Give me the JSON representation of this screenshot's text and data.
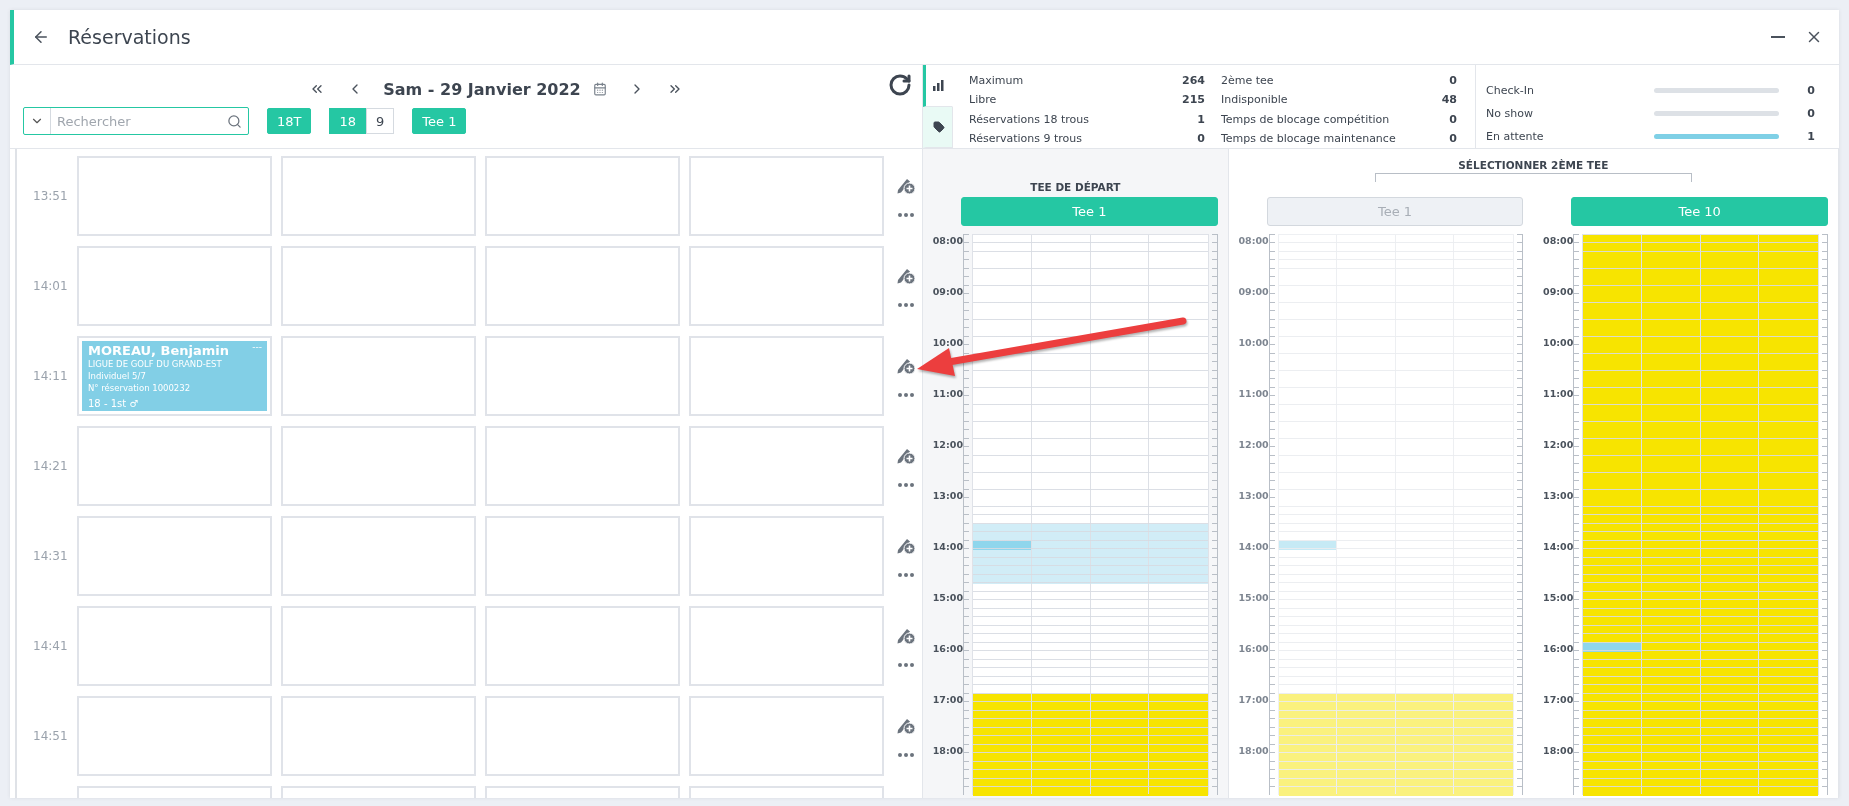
{
  "window": {
    "title": "Réservations"
  },
  "date_nav": {
    "date": "Sam - 29 Janvier 2022"
  },
  "search": {
    "placeholder": "Rechercher"
  },
  "course_filter": {
    "label": "18T",
    "selected": true
  },
  "holes_toggle": [
    {
      "label": "18",
      "selected": true
    },
    {
      "label": "9",
      "selected": false
    }
  ],
  "tee_filter": {
    "label": "Tee 1",
    "selected": true
  },
  "slots": [
    {
      "time": "13:51",
      "cells": [
        {
          "kind": "empty"
        },
        {
          "kind": "empty"
        },
        {
          "kind": "empty"
        },
        {
          "kind": "empty"
        }
      ]
    },
    {
      "time": "14:01",
      "cells": [
        {
          "kind": "empty"
        },
        {
          "kind": "empty"
        },
        {
          "kind": "empty"
        },
        {
          "kind": "empty"
        }
      ]
    },
    {
      "time": "14:11",
      "cells": [
        {
          "kind": "booking",
          "name": "MOREAU, Benjamin",
          "club": "LIGUE DE GOLF DU GRAND-EST",
          "type": "Individuel 5/7",
          "reference": "N° réservation 1000232",
          "holes": "18 - 1st",
          "gender": "♂",
          "marker": "---"
        },
        {
          "kind": "empty"
        },
        {
          "kind": "empty"
        },
        {
          "kind": "empty"
        }
      ]
    },
    {
      "time": "14:21",
      "cells": [
        {
          "kind": "empty"
        },
        {
          "kind": "empty"
        },
        {
          "kind": "empty"
        },
        {
          "kind": "empty"
        }
      ]
    },
    {
      "time": "14:31",
      "cells": [
        {
          "kind": "empty"
        },
        {
          "kind": "empty"
        },
        {
          "kind": "empty"
        },
        {
          "kind": "empty"
        }
      ]
    },
    {
      "time": "14:41",
      "cells": [
        {
          "kind": "empty"
        },
        {
          "kind": "empty"
        },
        {
          "kind": "empty"
        },
        {
          "kind": "empty"
        }
      ]
    },
    {
      "time": "14:51",
      "cells": [
        {
          "kind": "empty"
        },
        {
          "kind": "empty"
        },
        {
          "kind": "empty"
        },
        {
          "kind": "empty"
        }
      ]
    },
    {
      "cells": [
        {
          "kind": "empty"
        },
        {
          "kind": "empty"
        },
        {
          "kind": "empty"
        },
        {
          "kind": "empty"
        }
      ]
    }
  ],
  "stats": {
    "tabs": [
      {
        "kind": "chart",
        "selected": true
      },
      {
        "kind": "tag",
        "selected": false
      }
    ],
    "groups": [
      [
        {
          "label": "Maximum",
          "value": "264"
        },
        {
          "label": "Libre",
          "value": "215"
        },
        {
          "label": "Réservations 18 trous",
          "value": "1"
        },
        {
          "label": "Réservations 9 trous",
          "value": "0"
        }
      ],
      [
        {
          "label": "2ème tee",
          "value": "0"
        },
        {
          "label": "Indisponible",
          "value": "48"
        },
        {
          "label": "Temps de blocage compétition",
          "value": "0"
        },
        {
          "label": "Temps de blocage maintenance",
          "value": "0"
        }
      ]
    ],
    "meters": [
      {
        "label": "Check-In",
        "level": 0,
        "value": "0"
      },
      {
        "label": "No show",
        "level": 0,
        "value": "0"
      },
      {
        "label": "En attente",
        "level": 1,
        "value": "1"
      }
    ]
  },
  "tee_groups": [
    {
      "heading": "TEE DE DÉPART",
      "panels": [
        {
          "button": {
            "label": "Tee 1",
            "selected": true
          },
          "hours": [
            {
              "label": "08:00",
              "window": false,
              "booking": false,
              "blocked": false
            },
            {
              "label": "09:00",
              "window": false,
              "booking": false,
              "blocked": false
            },
            {
              "label": "10:00",
              "window": false,
              "booking": false,
              "blocked": false
            },
            {
              "label": "11:00",
              "window": false,
              "booking": false,
              "blocked": false
            },
            {
              "label": "12:00",
              "window": false,
              "booking": false,
              "blocked": false
            },
            {
              "label": "13:00",
              "window": false,
              "booking": false,
              "blocked": false
            },
            {
              "label": "14:00",
              "window": true,
              "booking": true,
              "blocked": false
            },
            {
              "label": "15:00",
              "window": false,
              "booking": false,
              "blocked": false
            },
            {
              "label": "16:00",
              "window": false,
              "booking": false,
              "blocked": false
            },
            {
              "label": "17:00",
              "window": false,
              "booking": false,
              "blocked": true
            },
            {
              "label": "18:00",
              "window": false,
              "booking": false,
              "blocked": true
            }
          ]
        }
      ]
    },
    {
      "heading": "SÉLECTIONNER 2ÈME TEE",
      "panels": [
        {
          "button": {
            "label": "Tee 1",
            "selected": false
          },
          "hours": [
            {
              "label": "08:00",
              "window": false,
              "booking": false,
              "blocked": false
            },
            {
              "label": "09:00",
              "window": false,
              "booking": false,
              "blocked": false
            },
            {
              "label": "10:00",
              "window": false,
              "booking": false,
              "blocked": false
            },
            {
              "label": "11:00",
              "window": false,
              "booking": false,
              "blocked": false
            },
            {
              "label": "12:00",
              "window": false,
              "booking": false,
              "blocked": false
            },
            {
              "label": "13:00",
              "window": false,
              "booking": false,
              "blocked": false
            },
            {
              "label": "14:00",
              "window": false,
              "booking": true,
              "blocked": false
            },
            {
              "label": "15:00",
              "window": false,
              "booking": false,
              "blocked": false
            },
            {
              "label": "16:00",
              "window": false,
              "booking": false,
              "blocked": false
            },
            {
              "label": "17:00",
              "window": false,
              "booking": false,
              "blocked": true
            },
            {
              "label": "18:00",
              "window": false,
              "booking": false,
              "blocked": true
            }
          ]
        },
        {
          "button": {
            "label": "Tee 10",
            "selected": true
          },
          "hours": [
            {
              "label": "08:00",
              "window": false,
              "booking": false,
              "blocked": true
            },
            {
              "label": "09:00",
              "window": false,
              "booking": false,
              "blocked": true
            },
            {
              "label": "10:00",
              "window": false,
              "booking": false,
              "blocked": true
            },
            {
              "label": "11:00",
              "window": false,
              "booking": false,
              "blocked": true
            },
            {
              "label": "12:00",
              "window": false,
              "booking": false,
              "blocked": true
            },
            {
              "label": "13:00",
              "window": false,
              "booking": false,
              "blocked": true
            },
            {
              "label": "14:00",
              "window": false,
              "booking": false,
              "blocked": true
            },
            {
              "label": "15:00",
              "window": false,
              "booking": false,
              "blocked": true
            },
            {
              "label": "16:00",
              "window": false,
              "booking": true,
              "blocked": true
            },
            {
              "label": "17:00",
              "window": false,
              "booking": false,
              "blocked": true
            },
            {
              "label": "18:00",
              "window": false,
              "booking": false,
              "blocked": true
            }
          ]
        }
      ]
    }
  ],
  "annotation": {
    "kind": "arrow"
  }
}
